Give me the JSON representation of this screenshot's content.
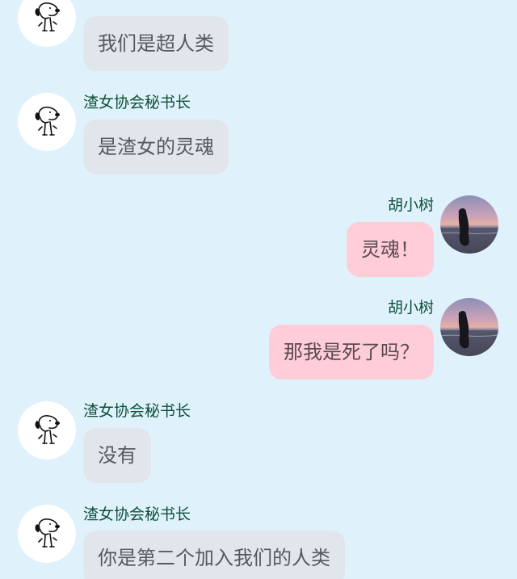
{
  "conversation": {
    "messages": [
      {
        "sender": "渣女协会秘书长",
        "side": "left",
        "text": "我们是超人类",
        "avatar_icon": "snoopy-avatar-icon"
      },
      {
        "sender": "渣女协会秘书长",
        "side": "left",
        "text": "是渣女的灵魂",
        "avatar_icon": "snoopy-avatar-icon"
      },
      {
        "sender": "胡小树",
        "side": "right",
        "text": "灵魂！",
        "avatar_icon": "sunset-beach-avatar-icon"
      },
      {
        "sender": "胡小树",
        "side": "right",
        "text": "那我是死了吗？",
        "avatar_icon": "sunset-beach-avatar-icon"
      },
      {
        "sender": "渣女协会秘书长",
        "side": "left",
        "text": "没有",
        "avatar_icon": "snoopy-avatar-icon"
      },
      {
        "sender": "渣女协会秘书长",
        "side": "left",
        "text": "你是第二个加入我们的人类",
        "avatar_icon": "snoopy-avatar-icon"
      }
    ]
  },
  "colors": {
    "background": "#dff2fb",
    "left_bubble": "#e1e6ec",
    "right_bubble": "#fecdd8",
    "name_text": "#0f4f3a"
  }
}
